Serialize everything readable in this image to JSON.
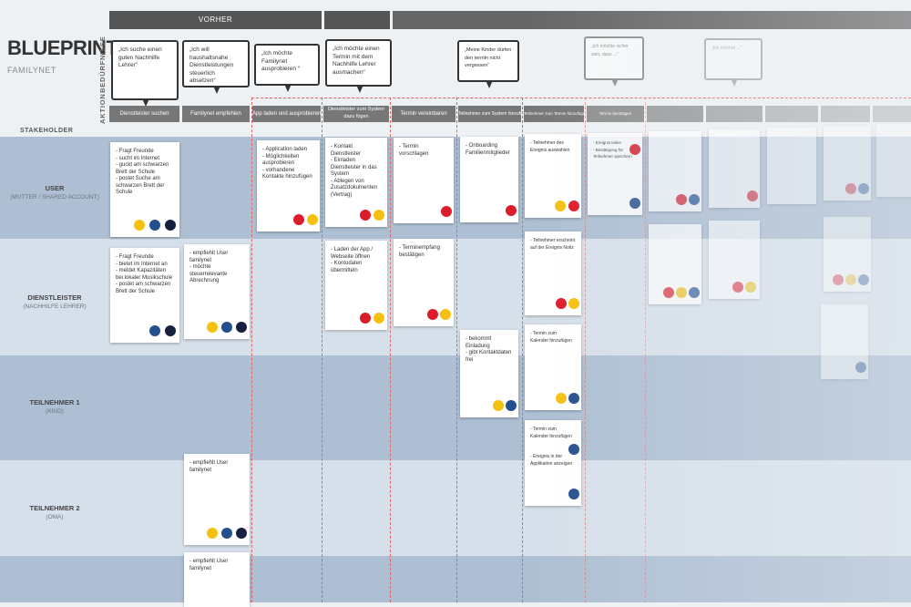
{
  "title": "BLUEPRINT",
  "subtitle": "FAMILYNET",
  "labels": {
    "beduerfnisse": "BEDÜRFNISSE",
    "aktion": "AKTION",
    "stakeholder": "STAKEHOLDER"
  },
  "phases": [
    "VORHER",
    "",
    ""
  ],
  "actions": [
    "Dienstleister suchen",
    "Familynet empfehlen",
    "App laden und ausprobieren",
    "Dienstleister zum System dazu fügen",
    "Termin vereinbaren",
    "Teilnehmer zum System hinzufügen",
    "Teilnehmer zum Termin hinzufügen",
    "Termin bestätigen",
    "",
    "",
    "",
    "",
    ""
  ],
  "needs": [
    "„Ich suche einen guten Nachhilfe Lehrer“",
    "„Ich will haushaltsnahe Dienstleistungen steuerlich absetzen“",
    "„Ich möchte Familynet ausprobieren “",
    "„Ich möchte einen Termin mit dem Nachhilfe Lehrer ausmachen“",
    "„Meine Kinder dürfen den termin nicht vergessen“",
    "„Ich möchte sicher sein, dass ...“",
    "„Ich möchte ...“"
  ],
  "stakeholders": [
    {
      "name": "USER",
      "sub": "(MUTTER / SHARED ACCOUNT)"
    },
    {
      "name": "DIENSTLEISTER",
      "sub": "(NACHHILFE LEHRER)"
    },
    {
      "name": "TEILNEHMER 1",
      "sub": "(KIND)"
    },
    {
      "name": "TEILNEHMER 2",
      "sub": "(OMA)"
    }
  ],
  "cards": [
    "- Fragt Freunde\n- sucht im Internet\n- guckt am schwarzen Brett der Schule\n- postet Suche am schwarzen Brett der Schule",
    "- Application laden\n- Möglichkeiten ausprobieren\n- vorhandene Kontakte hinzufügen",
    "- Kontakt Dienstleister\n- Einladen Dienstleister in das System\n- Ablegen von Zusatzdokumenten (Vertrag)",
    "- Termin vorschlagen",
    "- Onboarding Familienmitglieder",
    "- Teilnehmer des Ereignis auswählen",
    "- Ereignis teilen\n- Bestätigung für Teilnehmer speichern",
    "- Fragt Freunde\n- bietet im Internet an\n- meldet Kapazitäten bei lokaler Musikschule\n- postet am schwarzen Brett der Schule",
    "- empfiehlt User familynet\n- möchte steuerrelevante Abrechnung",
    "- Laden der App / Webseite öffnen\n- Kontodaten übermitteln",
    "- Terminempfang bestätigen",
    "- Teilnehmer erscheint auf der Ereignis Notiz",
    "- bekommt Einladung\n- gibt Kontaktdaten frei",
    "- Termin zum Kalender hinzufügen",
    "- empfiehlt User familynet",
    "- Termin zum Kalender hinzufügen\n\n\n- Ereignis in der Applikation anzeigen",
    "- empfiehlt User familynet"
  ],
  "colors": {
    "yellow": "#f5c012",
    "blue": "#244f8e",
    "navy": "#16213f",
    "red": "#dc1c2a",
    "row_dark": "#aebfd3",
    "row_light": "#d6e0ea"
  }
}
